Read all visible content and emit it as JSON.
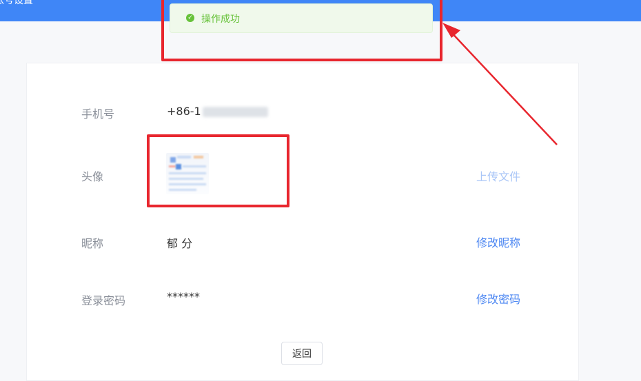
{
  "header": {
    "title": "账号设置",
    "bg_color": "#3f86f7"
  },
  "toast": {
    "message": "操作成功",
    "icon": "check-circle-icon",
    "color": "#67c23a"
  },
  "profile": {
    "phone_label": "手机号",
    "phone_value": "+86-1",
    "avatar_label": "头像",
    "avatar_action": "上传文件",
    "nickname_label": "昵称",
    "nickname_value": "郁 分",
    "nickname_action": "修改昵称",
    "password_label": "登录密码",
    "password_value": "******",
    "password_action": "修改密码"
  },
  "footer": {
    "return_label": "返回"
  },
  "annotation_color": "#e8262e"
}
